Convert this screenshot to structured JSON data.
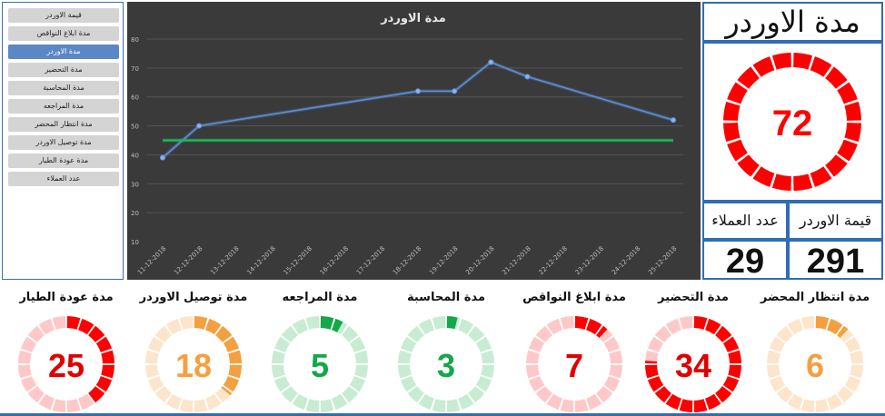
{
  "slicer": {
    "items": [
      {
        "label": "قيمة الاوردر",
        "selected": false
      },
      {
        "label": "مدة ابلاغ النواقص",
        "selected": false
      },
      {
        "label": "مدة الاوردر",
        "selected": true
      },
      {
        "label": "مدة التحضير",
        "selected": false
      },
      {
        "label": "مدة المحاسبة",
        "selected": false
      },
      {
        "label": "مدة المراجعه",
        "selected": false
      },
      {
        "label": "مدة انتظار المحضر",
        "selected": false
      },
      {
        "label": "مدة توصيل الاوردر",
        "selected": false
      },
      {
        "label": "مدة عودة الطيار",
        "selected": false
      },
      {
        "label": "عدد العملاء",
        "selected": false
      }
    ]
  },
  "chart_data": {
    "type": "line",
    "title": "مدة الاوردر",
    "x": [
      "11-12-2018",
      "12-12-2018",
      "13-12-2018",
      "14-12-2018",
      "15-12-2018",
      "16-12-2018",
      "17-12-2018",
      "18-12-2018",
      "19-12-2018",
      "20-12-2018",
      "21-12-2018",
      "22-12-2018",
      "23-12-2018",
      "24-12-2018",
      "25-12-2018"
    ],
    "series": [
      {
        "values": [
          39,
          50,
          null,
          null,
          null,
          null,
          null,
          62,
          62,
          72,
          67,
          null,
          null,
          null,
          52
        ],
        "color": "#5b8fd6"
      },
      {
        "values": [
          45,
          45,
          45,
          45,
          45,
          45,
          45,
          45,
          45,
          45,
          45,
          45,
          45,
          45,
          45
        ],
        "color": "#16c25a"
      }
    ],
    "yticks": [
      10,
      20,
      30,
      40,
      50,
      60,
      70,
      80
    ],
    "ylim": [
      10,
      80
    ],
    "grid": true,
    "xlabel": "",
    "ylabel": ""
  },
  "kpi": {
    "title": "مدة الاوردر",
    "value": "72",
    "value_fraction": 1.0,
    "color": "#ff0000",
    "customers_label": "عدد العملاء",
    "customers_value": "29",
    "order_value_label": "قيمة الاوردر",
    "order_value": "291"
  },
  "gauges": [
    {
      "title": "مدة انتظار المحضر",
      "value": "6",
      "fraction": 0.12,
      "color": "#f5a040",
      "bg": "#fde5cc",
      "text_color": "#f5a040"
    },
    {
      "title": "مدة التحضير",
      "value": "34",
      "fraction": 0.76,
      "color": "#ff0000",
      "bg": "#ffc8c8",
      "text_color": "#e00000"
    },
    {
      "title": "مدة ابلاغ النواقص",
      "value": "7",
      "fraction": 0.12,
      "color": "#ff0000",
      "bg": "#ffc8c8",
      "text_color": "#e00000"
    },
    {
      "title": "مدة المحاسبة",
      "value": "3",
      "fraction": 0.04,
      "color": "#13a84a",
      "bg": "#c8ecd3",
      "text_color": "#13a84a"
    },
    {
      "title": "مدة المراجعه",
      "value": "5",
      "fraction": 0.08,
      "color": "#13a84a",
      "bg": "#c8ecd3",
      "text_color": "#13a84a"
    },
    {
      "title": "مدة توصيل الاوردر",
      "value": "18",
      "fraction": 0.36,
      "color": "#f5a040",
      "bg": "#fde5cc",
      "text_color": "#f5a040"
    },
    {
      "title": "مدة عودة الطيار",
      "value": "25",
      "fraction": 0.4,
      "color": "#ff0000",
      "bg": "#ffc8c8",
      "text_color": "#e00000"
    }
  ]
}
